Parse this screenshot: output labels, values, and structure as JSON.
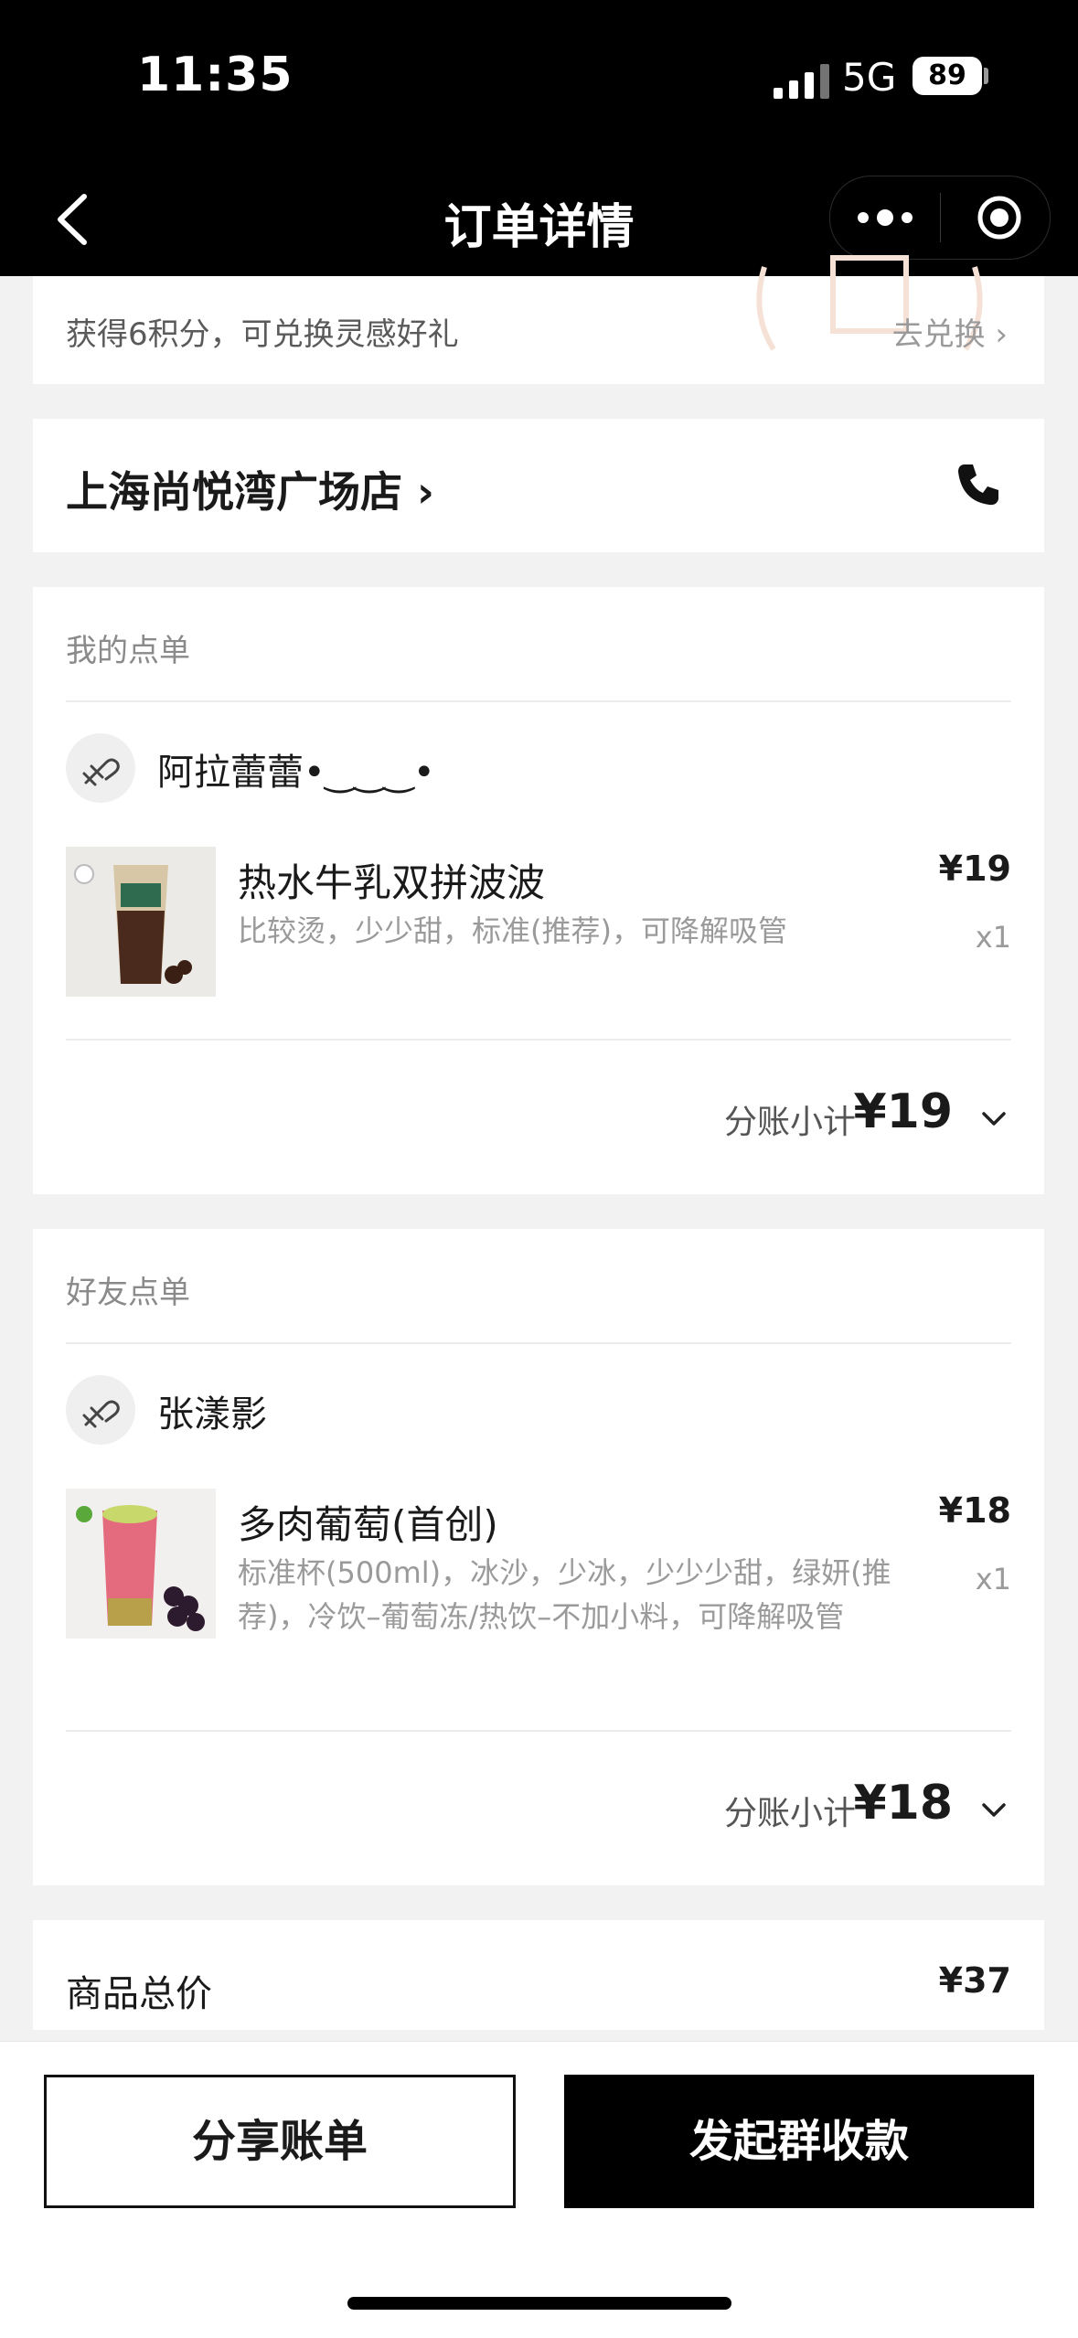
{
  "status": {
    "time": "11:35",
    "network": "5G",
    "battery": "89"
  },
  "nav": {
    "title": "订单详情"
  },
  "points": {
    "text": "获得6积分，可兑换灵感好礼",
    "link": "去兑换 ›"
  },
  "store": {
    "name": "上海尚悦湾广场店 ›"
  },
  "my_order": {
    "section_title": "我的点单",
    "user": "阿拉蕾蕾•‿‿‿•",
    "item": {
      "name": "热水牛乳双拼波波",
      "desc": "比较烫，少少甜，标准(推荐)，可降解吸管",
      "price": "¥19",
      "qty": "x1"
    },
    "subtotal_label": "分账小计",
    "subtotal": "¥19"
  },
  "friend_order": {
    "section_title": "好友点单",
    "user": "张漾影",
    "item": {
      "name": "多肉葡萄(首创)",
      "desc": "标准杯(500ml)，冰沙，少冰，少少少甜，绿妍(推荐)，冷饮–葡萄冻/热饮–不加小料，可降解吸管",
      "price": "¥18",
      "qty": "x1"
    },
    "subtotal_label": "分账小计",
    "subtotal": "¥18"
  },
  "total": {
    "label": "商品总价",
    "value": "¥37"
  },
  "actions": {
    "share": "分享账单",
    "collect": "发起群收款"
  },
  "icons": [
    "back-icon",
    "more-icon",
    "record-icon",
    "phone-icon",
    "avatar-icon",
    "chevron-down-icon"
  ],
  "colors": {
    "header": "#000000",
    "background": "#f2f2f2",
    "primary_button": "#000000"
  }
}
